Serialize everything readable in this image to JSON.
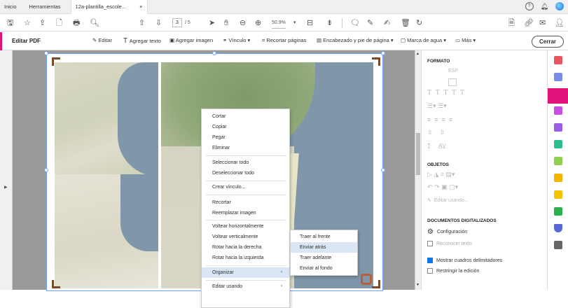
{
  "tabs": {
    "home": "Inicio",
    "tools": "Herramientas",
    "doc": "12a-plantilla_escole...",
    "doc_close": "×"
  },
  "toolbar": {
    "page_current": "3",
    "page_total": "/ 5",
    "zoom": "50.9%",
    "zoom_arrow": "▾"
  },
  "editbar": {
    "title": "Editar PDF",
    "items": [
      "Editar",
      "Agregar texto",
      "Agregar imagen",
      "Vínculo ▾",
      "Recortar páginas",
      "Encabezado y pie de página ▾",
      "Marca de agua ▾",
      "Más ▾"
    ],
    "close": "Cerrar"
  },
  "context_menu": {
    "items": [
      "Cortar",
      "Copiar",
      "Pegar",
      "Eliminar",
      "Seleccionar todo",
      "Deseleccionar todo",
      "Crear vínculo...",
      "Recortar",
      "Reemplazar imagen",
      "Voltear horizontalmente",
      "Voltear verticalmente",
      "Rotar hacia la derecha",
      "Rotar hacia la izquierda",
      "Organizar",
      "Editar usando"
    ],
    "arrow": "›"
  },
  "submenu": {
    "items": [
      "Traer al frente",
      "Enviar atrás",
      "Traer adelante",
      "Enviar al fondo"
    ]
  },
  "panel": {
    "formato": "FORMATO",
    "font_placeholder": "ESP",
    "objetos": "OBJETOS",
    "editar_usando": "Editar usando...",
    "doc_digital": "DOCUMENTOS DIGITALIZADOS",
    "configuracion": "Configuración",
    "reconocer": "Reconocer texto",
    "mostrar": "Mostrar cuadros delimitadores",
    "restringir": "Restringir la edición"
  },
  "colors": {
    "accent": "#e0137c",
    "selection": "#6aa2ff",
    "highlight": "#dbe6f5",
    "check": "#1473e6"
  }
}
